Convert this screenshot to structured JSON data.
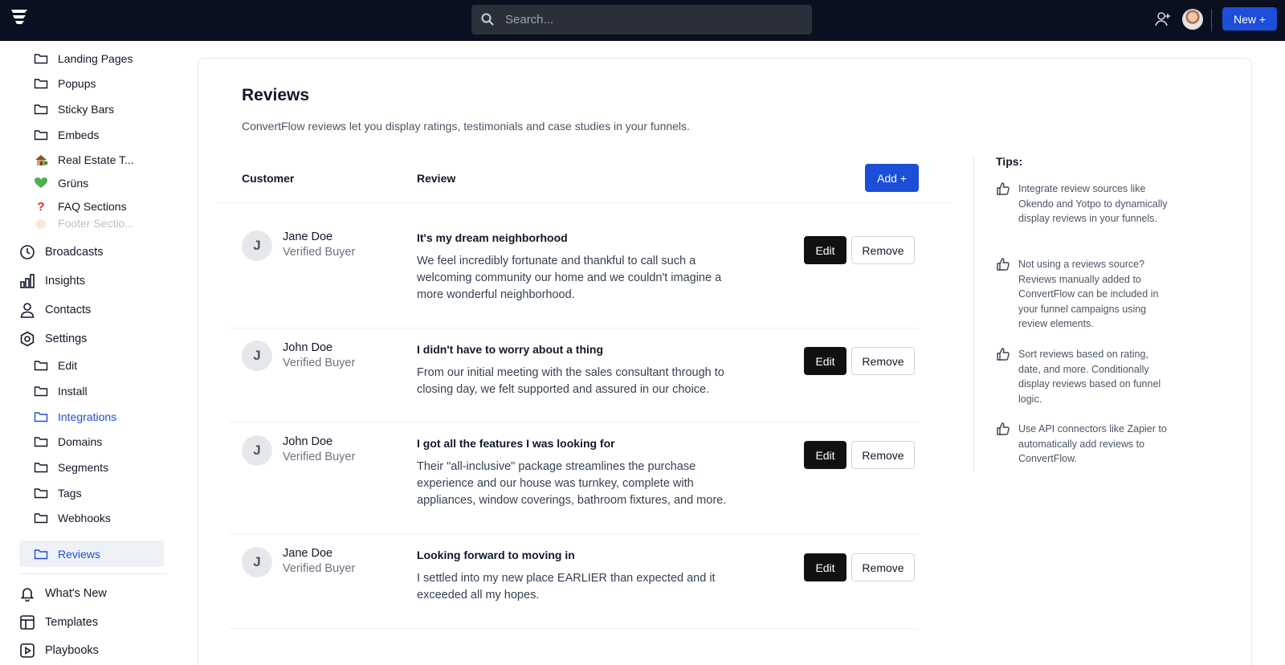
{
  "topbar": {
    "search_placeholder": "Search...",
    "new_button": "New +"
  },
  "sidebar": {
    "subitems_top": [
      {
        "label": "Landing Pages",
        "icon": "folder-icon"
      },
      {
        "label": "Popups",
        "icon": "folder-icon"
      },
      {
        "label": "Sticky Bars",
        "icon": "folder-icon"
      },
      {
        "label": "Embeds",
        "icon": "folder-icon"
      },
      {
        "label": "Real Estate T...",
        "icon": "house-emoji-icon"
      },
      {
        "label": "Grüns",
        "icon": "green-heart-icon"
      },
      {
        "label": "FAQ Sections",
        "icon": "question-mark-icon"
      },
      {
        "label": "Footer Sectio...",
        "icon": "footer-emoji-icon"
      }
    ],
    "main_items": [
      {
        "label": "Broadcasts",
        "icon": "clock-icon"
      },
      {
        "label": "Insights",
        "icon": "bar-chart-icon"
      },
      {
        "label": "Contacts",
        "icon": "person-icon"
      },
      {
        "label": "Settings",
        "icon": "gear-icon"
      }
    ],
    "settings_items": [
      {
        "label": "Edit",
        "icon": "folder-icon"
      },
      {
        "label": "Install",
        "icon": "folder-icon"
      },
      {
        "label": "Integrations",
        "icon": "folder-icon"
      },
      {
        "label": "Domains",
        "icon": "folder-icon"
      },
      {
        "label": "Segments",
        "icon": "folder-icon"
      },
      {
        "label": "Tags",
        "icon": "folder-icon"
      },
      {
        "label": "Webhooks",
        "icon": "folder-icon"
      },
      {
        "label": "Reviews",
        "icon": "folder-icon"
      }
    ],
    "bottom_items": [
      {
        "label": "What's New",
        "icon": "bell-icon"
      },
      {
        "label": "Templates",
        "icon": "layout-icon"
      },
      {
        "label": "Playbooks",
        "icon": "play-icon"
      }
    ],
    "active_item": "Reviews",
    "highlighted_item": "Integrations"
  },
  "main": {
    "title": "Reviews",
    "description": "ConvertFlow reviews let you display ratings, testimonials and case studies in your funnels.",
    "columns": {
      "customer": "Customer",
      "review": "Review"
    },
    "add_button": "Add +",
    "reviews": [
      {
        "initial": "J",
        "name": "Jane Doe",
        "role": "Verified Buyer",
        "title": "It's my dream neighborhood",
        "body": "We feel incredibly fortunate and thankful to call such a welcoming community our home and we couldn't imagine a more wonderful neighborhood.",
        "edit": "Edit",
        "remove": "Remove"
      },
      {
        "initial": "J",
        "name": "John Doe",
        "role": "Verified Buyer",
        "title": "I didn't have to worry about a thing",
        "body": "From our initial meeting with the sales consultant through to closing day, we felt supported and assured in our choice.",
        "edit": "Edit",
        "remove": "Remove"
      },
      {
        "initial": "J",
        "name": "John Doe",
        "role": "Verified Buyer",
        "title": "I got all the features I was looking for",
        "body": "Their \"all-inclusive\" package streamlines the purchase experience and our house was turnkey, complete with appliances, window coverings, bathroom fixtures, and more.",
        "edit": "Edit",
        "remove": "Remove"
      },
      {
        "initial": "J",
        "name": "Jane Doe",
        "role": "Verified Buyer",
        "title": "Looking forward to moving in",
        "body": "I settled into my new place EARLIER than expected and it exceeded all my hopes.",
        "edit": "Edit",
        "remove": "Remove"
      }
    ]
  },
  "tips": {
    "title": "Tips:",
    "items": [
      "Integrate review sources like Okendo and Yotpo to dynamically display reviews in your funnels.",
      "Not using a reviews source? Reviews manually added to ConvertFlow can be included in your funnel campaigns using review elements.",
      "Sort reviews based on rating, date, and more. Conditionally display reviews based on funnel logic.",
      "Use API connectors like Zapier to automatically add reviews to ConvertFlow."
    ]
  },
  "colors": {
    "topbar": "#0b1020",
    "accent": "#1d4ed8",
    "edit_button": "#111111",
    "active_nav_bg": "#eef2f7"
  }
}
